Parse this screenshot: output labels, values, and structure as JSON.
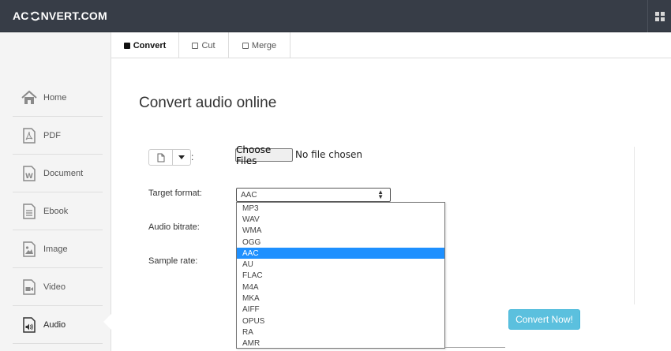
{
  "app": {
    "logo_prefix": "AC",
    "logo_suffix": "NVERT.COM",
    "colors": {
      "topbar": "#373d47",
      "accent": "#5bc0de",
      "selected_option": "#1e90ff"
    }
  },
  "sidebar": {
    "items": [
      {
        "label": "Home",
        "icon": "home-icon"
      },
      {
        "label": "PDF",
        "icon": "pdf-file-icon"
      },
      {
        "label": "Document",
        "icon": "word-document-icon"
      },
      {
        "label": "Ebook",
        "icon": "ebook-icon"
      },
      {
        "label": "Image",
        "icon": "image-icon"
      },
      {
        "label": "Video",
        "icon": "video-icon"
      },
      {
        "label": "Audio",
        "icon": "audio-icon",
        "active": true
      }
    ]
  },
  "tabs": [
    {
      "label": "Convert",
      "active": true
    },
    {
      "label": "Cut"
    },
    {
      "label": "Merge"
    }
  ],
  "main": {
    "heading": "Convert audio online",
    "file_source_colon": ":",
    "choose_files_label": "Choose Files",
    "no_file_text": "No file chosen",
    "target_format_label": "Target format:",
    "audio_bitrate_label": "Audio bitrate:",
    "sample_rate_label": "Sample rate:",
    "selected_format": "AAC",
    "format_options": [
      "MP3",
      "WAV",
      "WMA",
      "OGG",
      "AAC",
      "AU",
      "FLAC",
      "M4A",
      "MKA",
      "AIFF",
      "OPUS",
      "RA",
      "AMR"
    ],
    "convert_button_label": "Convert Now!"
  }
}
